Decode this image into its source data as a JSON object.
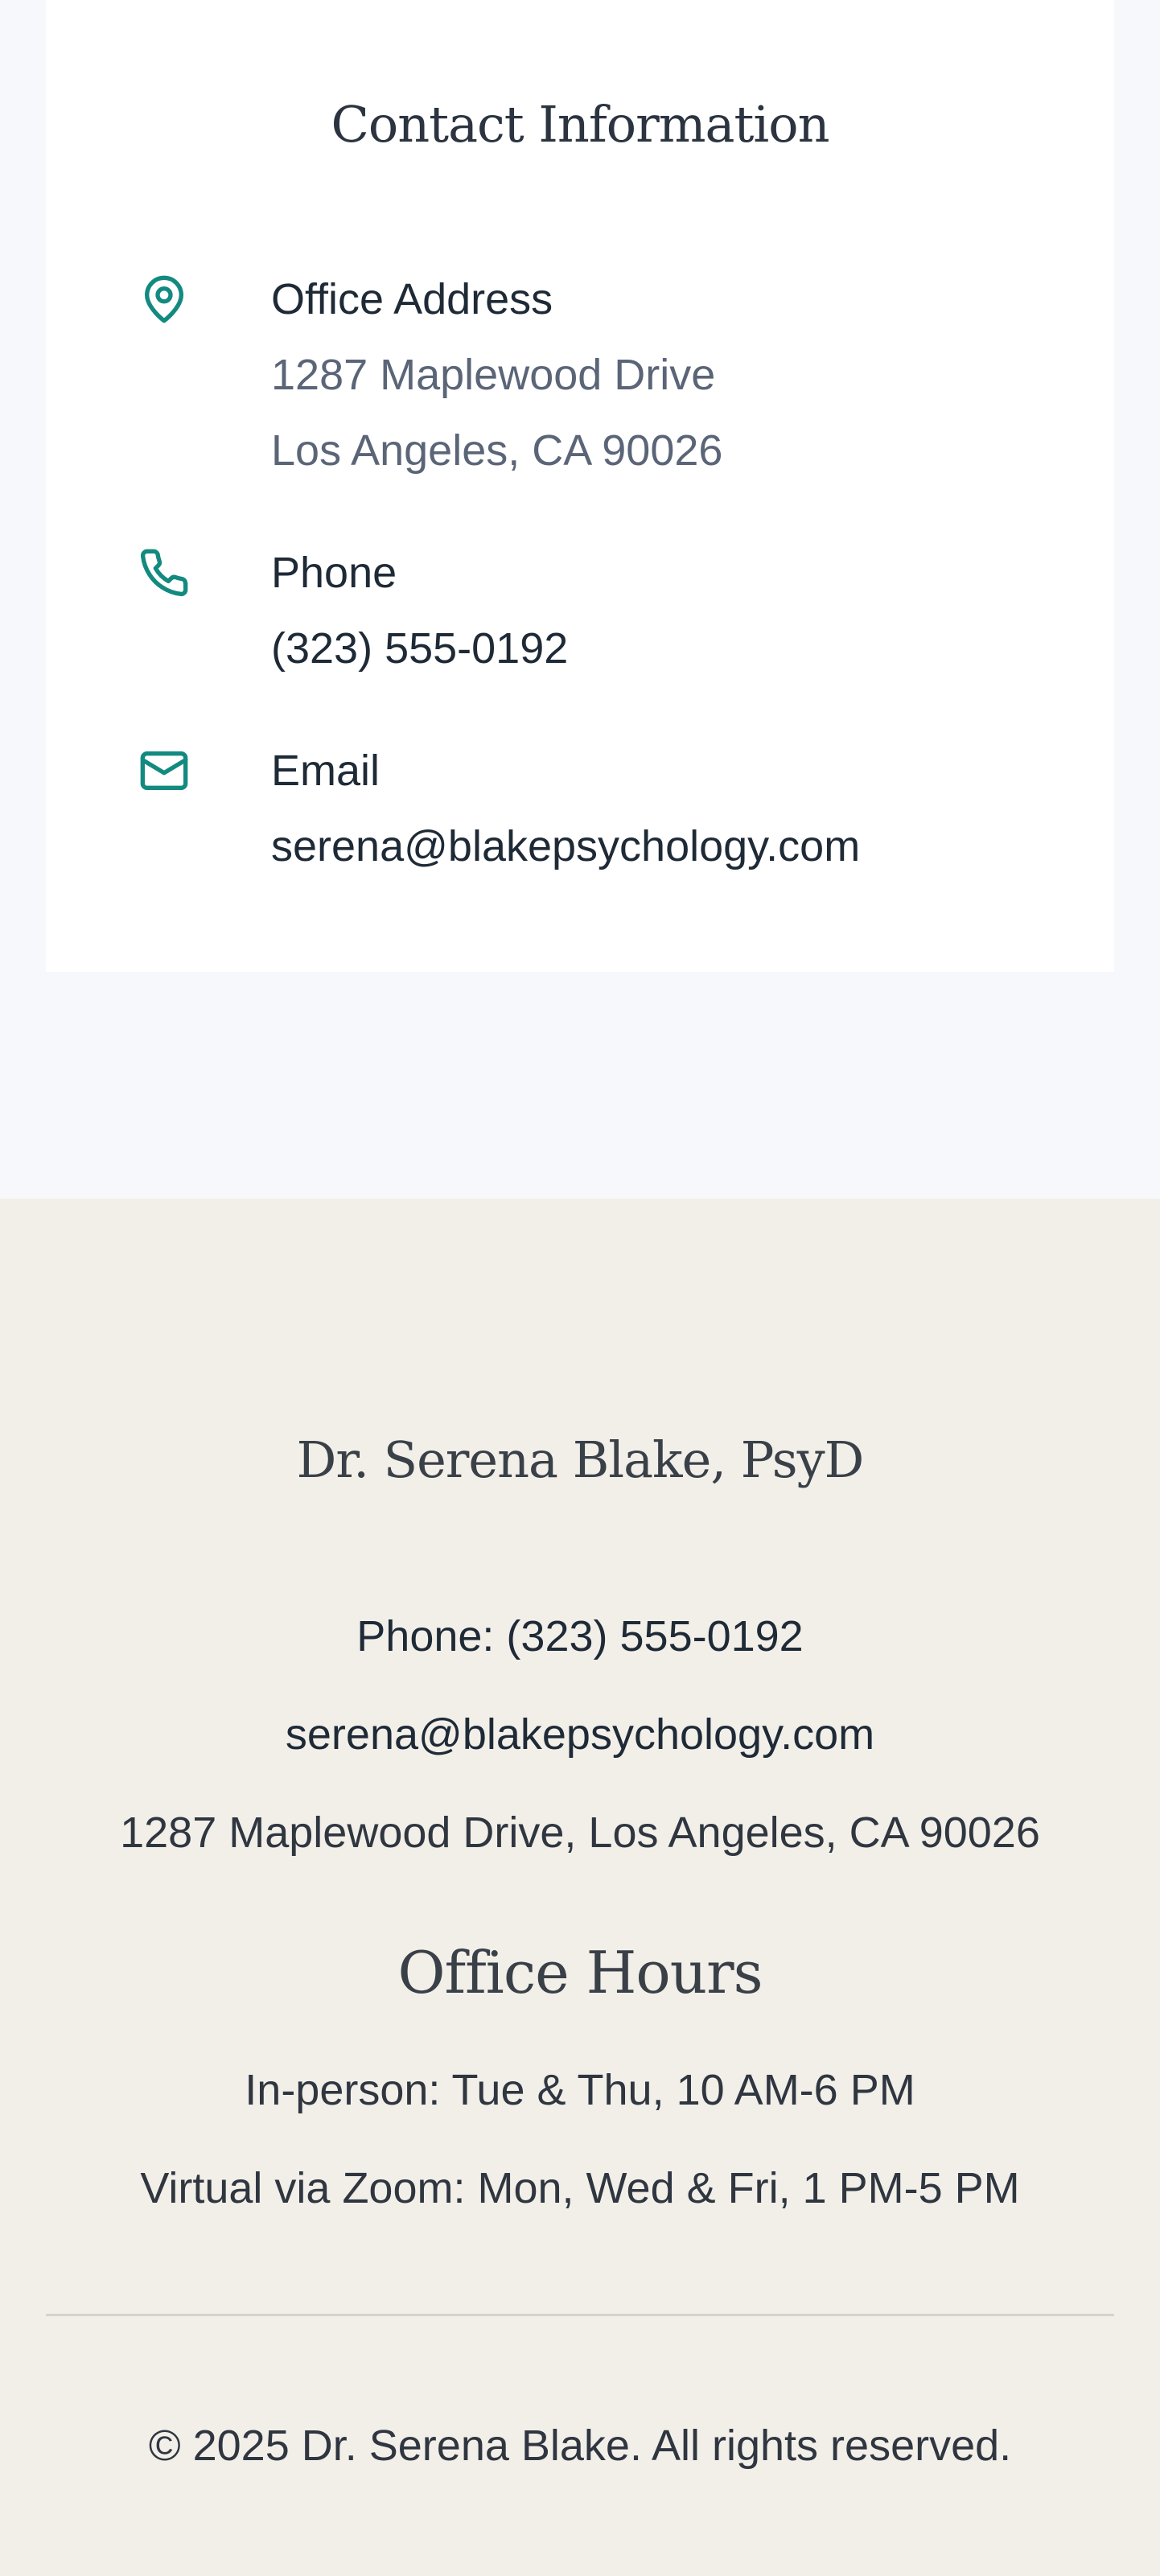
{
  "contact": {
    "title": "Contact Information",
    "accent_color": "#138a7f",
    "items": [
      {
        "icon": "map-pin-icon",
        "label": "Office Address",
        "lines": [
          "1287 Maplewood Drive",
          "Los Angeles, CA 90026"
        ]
      },
      {
        "icon": "phone-icon",
        "label": "Phone",
        "lines": [
          "(323) 555-0192"
        ]
      },
      {
        "icon": "mail-icon",
        "label": "Email",
        "lines": [
          "serena@blakepsychology.com"
        ]
      }
    ]
  },
  "footer": {
    "name": "Dr. Serena Blake, PsyD",
    "phone": "Phone: (323) 555-0192",
    "email": "serena@blakepsychology.com",
    "address": "1287 Maplewood Drive, Los Angeles, CA 90026",
    "hours_title": "Office Hours",
    "hours": [
      "In-person: Tue & Thu, 10 AM-6 PM",
      "Virtual via Zoom: Mon, Wed & Fri, 1 PM-5 PM"
    ],
    "copyright": "© 2025 Dr. Serena Blake. All rights reserved."
  }
}
